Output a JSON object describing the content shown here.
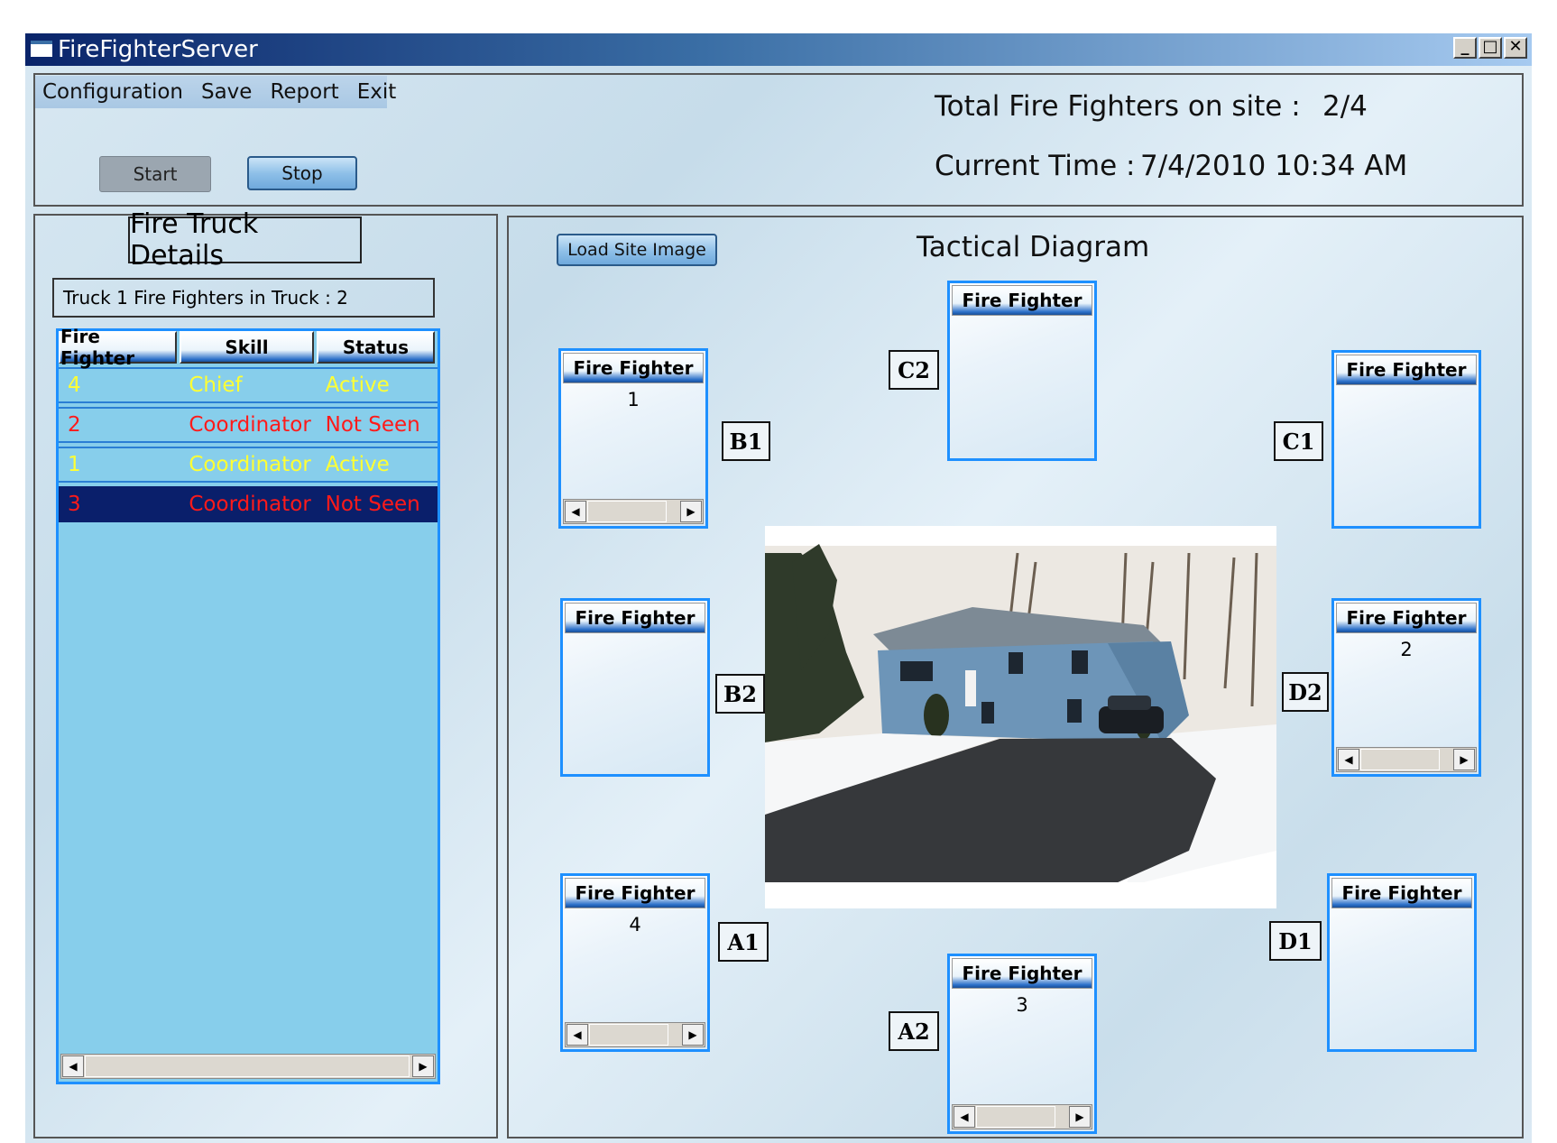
{
  "window": {
    "title": "FireFighterServer",
    "controls": [
      "_",
      "□",
      "✕"
    ]
  },
  "menu": [
    "Configuration",
    "Save",
    "Report",
    "Exit"
  ],
  "controls": {
    "start_label": "Start",
    "stop_label": "Stop"
  },
  "status": {
    "total_label": "Total Fire Fighters on site :",
    "total_value": "2/4",
    "time_label": "Current Time :",
    "time_value": "7/4/2010 10:34 AM"
  },
  "truck_panel": {
    "title": "Fire Truck Details",
    "truck_info": "Truck 1  Fire Fighters in Truck : 2",
    "columns": [
      "Fire Fighter",
      "Skill",
      "Status"
    ],
    "rows": [
      {
        "id": "4",
        "skill": "Chief",
        "status": "Active",
        "color": "#ffff33",
        "selected": false
      },
      {
        "id": "2",
        "skill": "Coordinator",
        "status": "Not Seen",
        "color": "#ff1a1a",
        "selected": false
      },
      {
        "id": "1",
        "skill": "Coordinator",
        "status": "Active",
        "color": "#ffff33",
        "selected": false
      },
      {
        "id": "3",
        "skill": "Coordinator",
        "status": "Not Seen",
        "color": "#ff1a1a",
        "selected": true
      }
    ]
  },
  "diagram": {
    "load_button": "Load Site Image",
    "title": "Tactical Diagram",
    "box_header": "Fire Fighter",
    "zones": {
      "B1": {
        "label": "B1",
        "value": "1"
      },
      "C2": {
        "label": "C2",
        "value": ""
      },
      "C1": {
        "label": "C1",
        "value": ""
      },
      "B2": {
        "label": "B2",
        "value": ""
      },
      "D2": {
        "label": "D2",
        "value": "2"
      },
      "A1": {
        "label": "A1",
        "value": "4"
      },
      "A2": {
        "label": "A2",
        "value": "3"
      },
      "D1": {
        "label": "D1",
        "value": ""
      }
    }
  },
  "colors": {
    "accent_blue": "#1e90ff",
    "grid_bg": "#87ceeb",
    "selected_row": "#0a1f6b",
    "active": "#ffff33",
    "not_seen": "#ff1a1a"
  }
}
